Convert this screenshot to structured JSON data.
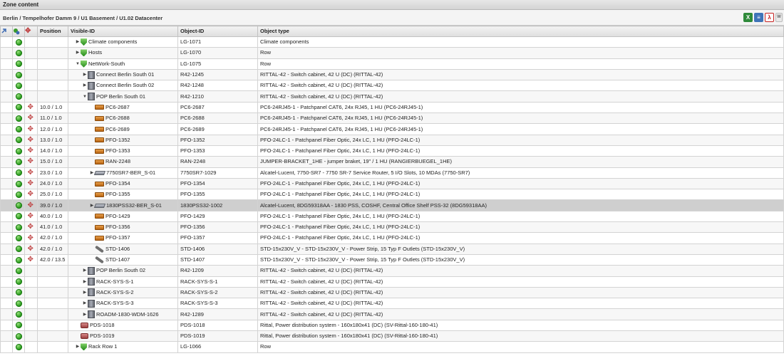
{
  "panel": {
    "title": "Zone content"
  },
  "breadcrumb": "Berlin / Tempelhofer Damm 9 / U1 Basement / U1.02 Datacenter",
  "toolbar": [
    "excel-export-icon",
    "csv-export-icon",
    "pdf-export-icon",
    "more-icon"
  ],
  "columns": {
    "position": "Position",
    "visible_id": "Visible-ID",
    "object_id": "Object-ID",
    "object_type": "Object type"
  },
  "rows": [
    {
      "position": "",
      "tri": "▶",
      "depth": 0,
      "icon": "shield",
      "visible_id": "Climate components",
      "object_id": "LG-1071",
      "object_type": "Climate components",
      "move": false
    },
    {
      "position": "",
      "tri": "▶",
      "depth": 0,
      "icon": "shield",
      "visible_id": "Hosts",
      "object_id": "LG-1070",
      "object_type": "Row",
      "move": false
    },
    {
      "position": "",
      "tri": "▼",
      "depth": 0,
      "icon": "shield",
      "visible_id": "NetWork-South",
      "object_id": "LG-1075",
      "object_type": "Row",
      "move": false
    },
    {
      "position": "",
      "tri": "▶",
      "depth": 1,
      "icon": "cabinet",
      "visible_id": "Connect Berlin South 01",
      "object_id": "R42-1245",
      "object_type": "RITTAL-42 - Switch cabinet, 42 U (DC) (RITTAL-42)",
      "move": false
    },
    {
      "position": "",
      "tri": "▶",
      "depth": 1,
      "icon": "cabinet",
      "visible_id": "Connect Berlin South 02",
      "object_id": "R42-1248",
      "object_type": "RITTAL-42 - Switch cabinet, 42 U (DC) (RITTAL-42)",
      "move": false
    },
    {
      "position": "",
      "tri": "▼",
      "depth": 1,
      "icon": "cabinet",
      "visible_id": "POP Berlin South 01",
      "object_id": "R42-1210",
      "object_type": "RITTAL-42 - Switch cabinet, 42 U (DC) (RITTAL-42)",
      "move": false
    },
    {
      "position": "10.0 / 1.0",
      "tri": "",
      "depth": 2,
      "icon": "panel",
      "visible_id": "PC6-2687",
      "object_id": "PC6-2687",
      "object_type": "PC6-24RJ45-1 - Patchpanel CAT6, 24x RJ45, 1 HU (PC6-24RJ45-1)",
      "move": true
    },
    {
      "position": "11.0 / 1.0",
      "tri": "",
      "depth": 2,
      "icon": "panel",
      "visible_id": "PC6-2688",
      "object_id": "PC6-2688",
      "object_type": "PC6-24RJ45-1 - Patchpanel CAT6, 24x RJ45, 1 HU (PC6-24RJ45-1)",
      "move": true
    },
    {
      "position": "12.0 / 1.0",
      "tri": "",
      "depth": 2,
      "icon": "panel",
      "visible_id": "PC6-2689",
      "object_id": "PC6-2689",
      "object_type": "PC6-24RJ45-1 - Patchpanel CAT6, 24x RJ45, 1 HU (PC6-24RJ45-1)",
      "move": true
    },
    {
      "position": "13.0 / 1.0",
      "tri": "",
      "depth": 2,
      "icon": "panel",
      "visible_id": "PFO-1352",
      "object_id": "PFO-1352",
      "object_type": "PFO-24LC-1 - Patchpanel Fiber Optic, 24x LC, 1 HU (PFO-24LC-1)",
      "move": true
    },
    {
      "position": "14.0 / 1.0",
      "tri": "",
      "depth": 2,
      "icon": "panel",
      "visible_id": "PFO-1353",
      "object_id": "PFO-1353",
      "object_type": "PFO-24LC-1 - Patchpanel Fiber Optic, 24x LC, 1 HU (PFO-24LC-1)",
      "move": true
    },
    {
      "position": "15.0 / 1.0",
      "tri": "",
      "depth": 2,
      "icon": "panel",
      "visible_id": "RAN-2248",
      "object_id": "RAN-2248",
      "object_type": "JUMPER-BRACKET_1HE - jumper braket, 19\" / 1 HU (RANGIERBUEGEL_1HE)",
      "move": true
    },
    {
      "position": "23.0 / 1.0",
      "tri": "▶",
      "depth": 2,
      "icon": "router",
      "visible_id": "7750SR7-BER_S-01",
      "object_id": "7750SR7-1029",
      "object_type": "Alcatel-Lucent, 7750-SR7 - 7750 SR-7 Service Router, 5 I/O Slots, 10 MDAs (7750-SR7)",
      "move": true
    },
    {
      "position": "24.0 / 1.0",
      "tri": "",
      "depth": 2,
      "icon": "panel",
      "visible_id": "PFO-1354",
      "object_id": "PFO-1354",
      "object_type": "PFO-24LC-1 - Patchpanel Fiber Optic, 24x LC, 1 HU (PFO-24LC-1)",
      "move": true
    },
    {
      "position": "25.0 / 1.0",
      "tri": "",
      "depth": 2,
      "icon": "panel",
      "visible_id": "PFO-1355",
      "object_id": "PFO-1355",
      "object_type": "PFO-24LC-1 - Patchpanel Fiber Optic, 24x LC, 1 HU (PFO-24LC-1)",
      "move": true
    },
    {
      "position": "39.0 / 1.0",
      "tri": "▶",
      "depth": 2,
      "icon": "router",
      "visible_id": "1830PSS32-BER_S-01",
      "object_id": "1830PSS32-1002",
      "object_type": "Alcatel-Lucent, 8DG59318AA - 1830 PSS, COSHF, Central Office Shelf PSS-32 (8DG59318AA)",
      "move": true,
      "selected": true
    },
    {
      "position": "40.0 / 1.0",
      "tri": "",
      "depth": 2,
      "icon": "panel",
      "visible_id": "PFO-1429",
      "object_id": "PFO-1429",
      "object_type": "PFO-24LC-1 - Patchpanel Fiber Optic, 24x LC, 1 HU (PFO-24LC-1)",
      "move": true
    },
    {
      "position": "41.0 / 1.0",
      "tri": "",
      "depth": 2,
      "icon": "panel",
      "visible_id": "PFO-1356",
      "object_id": "PFO-1356",
      "object_type": "PFO-24LC-1 - Patchpanel Fiber Optic, 24x LC, 1 HU (PFO-24LC-1)",
      "move": true
    },
    {
      "position": "42.0 / 1.0",
      "tri": "",
      "depth": 2,
      "icon": "panel",
      "visible_id": "PFO-1357",
      "object_id": "PFO-1357",
      "object_type": "PFO-24LC-1 - Patchpanel Fiber Optic, 24x LC, 1 HU (PFO-24LC-1)",
      "move": true
    },
    {
      "position": "42.0 / 1.0",
      "tri": "",
      "depth": 2,
      "icon": "strip",
      "visible_id": "STD-1406",
      "object_id": "STD-1406",
      "object_type": "STD-15x230V_V - STD-15x230V_V - Power Strip, 15 Typ F Outlets (STD-15x230V_V)",
      "move": true
    },
    {
      "position": "42.0 / 13.5",
      "tri": "",
      "depth": 2,
      "icon": "strip",
      "visible_id": "STD-1407",
      "object_id": "STD-1407",
      "object_type": "STD-15x230V_V - STD-15x230V_V - Power Strip, 15 Typ F Outlets (STD-15x230V_V)",
      "move": true
    },
    {
      "position": "",
      "tri": "▶",
      "depth": 1,
      "icon": "cabinet",
      "visible_id": "POP Berlin South 02",
      "object_id": "R42-1209",
      "object_type": "RITTAL-42 - Switch cabinet, 42 U (DC) (RITTAL-42)",
      "move": false
    },
    {
      "position": "",
      "tri": "▶",
      "depth": 1,
      "icon": "cabinet",
      "visible_id": "RACK-SYS-S-1",
      "object_id": "RACK-SYS-S-1",
      "object_type": "RITTAL-42 - Switch cabinet, 42 U (DC) (RITTAL-42)",
      "move": false
    },
    {
      "position": "",
      "tri": "▶",
      "depth": 1,
      "icon": "cabinet",
      "visible_id": "RACK-SYS-S-2",
      "object_id": "RACK-SYS-S-2",
      "object_type": "RITTAL-42 - Switch cabinet, 42 U (DC) (RITTAL-42)",
      "move": false
    },
    {
      "position": "",
      "tri": "▶",
      "depth": 1,
      "icon": "cabinet",
      "visible_id": "RACK-SYS-S-3",
      "object_id": "RACK-SYS-S-3",
      "object_type": "RITTAL-42 - Switch cabinet, 42 U (DC) (RITTAL-42)",
      "move": false
    },
    {
      "position": "",
      "tri": "▶",
      "depth": 1,
      "icon": "cabinet",
      "visible_id": "ROADM-1830-WDM-1626",
      "object_id": "R42-1289",
      "object_type": "RITTAL-42 - Switch cabinet, 42 U (DC) (RITTAL-42)",
      "move": false
    },
    {
      "position": "",
      "tri": "",
      "depth": 0,
      "icon": "pds",
      "visible_id": "PDS-1018",
      "object_id": "PDS-1018",
      "object_type": "Rittal, Power distribution system - 160x180x41 (DC) (SV-Rittal-160-180-41)",
      "move": false
    },
    {
      "position": "",
      "tri": "",
      "depth": 0,
      "icon": "pds",
      "visible_id": "PDS-1019",
      "object_id": "PDS-1019",
      "object_type": "Rittal, Power distribution system - 160x180x41 (DC) (SV-Rittal-160-180-41)",
      "move": false
    },
    {
      "position": "",
      "tri": "▶",
      "depth": 0,
      "icon": "shield",
      "visible_id": "Rack Row 1",
      "object_id": "LG-1066",
      "object_type": "Row",
      "move": false
    }
  ]
}
